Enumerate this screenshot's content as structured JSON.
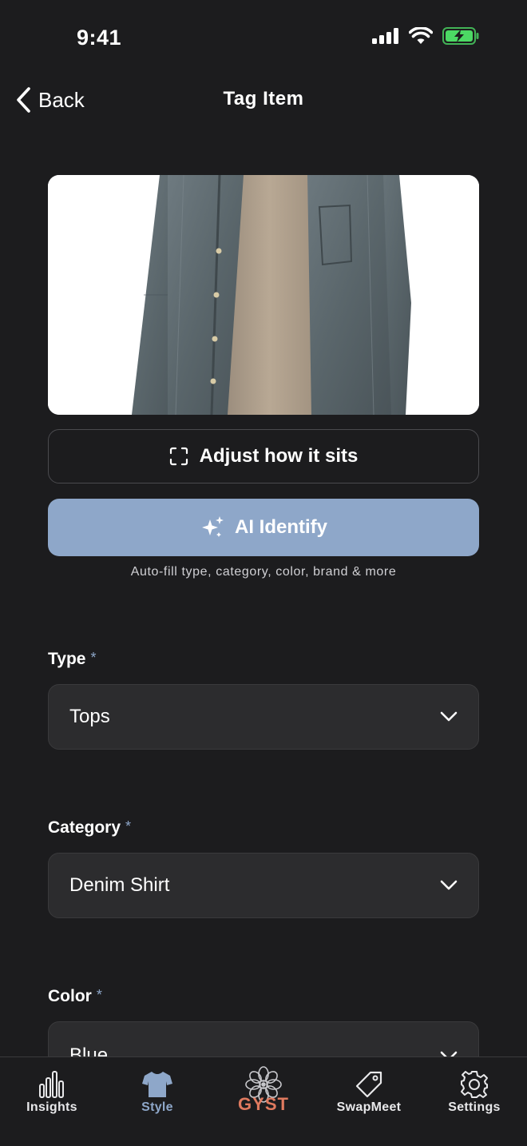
{
  "status_bar": {
    "time": "9:41"
  },
  "nav": {
    "back_label": "Back",
    "title": "Tag Item"
  },
  "actions": {
    "adjust_label": "Adjust how it sits",
    "ai_label": "AI Identify",
    "ai_hint": "Auto-fill type, category, color, brand & more"
  },
  "fields": [
    {
      "label": "Type",
      "required_mark": "*",
      "value": "Tops"
    },
    {
      "label": "Category",
      "required_mark": "*",
      "value": "Denim Shirt"
    },
    {
      "label": "Color",
      "required_mark": "*",
      "value": "Blue"
    }
  ],
  "tab_bar": {
    "items": [
      {
        "label": "Insights",
        "icon": "bar-chart-icon"
      },
      {
        "label": "Style",
        "icon": "tshirt-icon",
        "active": true
      },
      {
        "label": "GYST",
        "icon": "gyst-logo-icon"
      },
      {
        "label": "SwapMeet",
        "icon": "tag-icon"
      },
      {
        "label": "Settings",
        "icon": "gear-icon"
      }
    ]
  },
  "colors": {
    "background": "#1c1c1e",
    "accent_blue": "#8ea7c9",
    "field_bg": "#2c2c2e",
    "battery_green": "#4cd964",
    "gyst_orange": "#e07a5f"
  }
}
